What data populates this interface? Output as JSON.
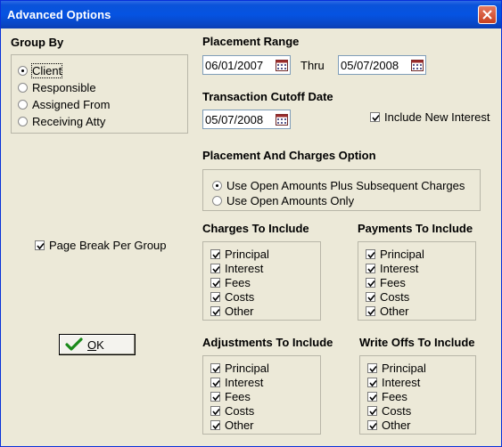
{
  "window": {
    "title": "Advanced Options"
  },
  "group_by": {
    "heading": "Group By",
    "options": [
      {
        "label": "Client",
        "selected": true
      },
      {
        "label": "Responsible",
        "selected": false
      },
      {
        "label": "Assigned From",
        "selected": false
      },
      {
        "label": "Receiving Atty",
        "selected": false
      }
    ]
  },
  "placement_range": {
    "heading": "Placement Range",
    "from": "06/01/2007",
    "thru_label": "Thru",
    "to": "05/07/2008"
  },
  "transaction_cutoff": {
    "heading": "Transaction Cutoff Date",
    "date": "05/07/2008"
  },
  "include_new_interest": {
    "label": "Include New Interest",
    "checked": true
  },
  "placement_charges_option": {
    "heading": "Placement And Charges Option",
    "options": [
      {
        "label": "Use Open Amounts Plus Subsequent Charges",
        "selected": true
      },
      {
        "label": "Use Open Amounts Only",
        "selected": false
      }
    ]
  },
  "page_break": {
    "label": "Page Break Per Group",
    "checked": true
  },
  "charges": {
    "heading": "Charges To Include",
    "items": [
      {
        "label": "Principal",
        "checked": true
      },
      {
        "label": "Interest",
        "checked": true
      },
      {
        "label": "Fees",
        "checked": true
      },
      {
        "label": "Costs",
        "checked": true
      },
      {
        "label": "Other",
        "checked": true
      }
    ]
  },
  "payments": {
    "heading": "Payments To Include",
    "items": [
      {
        "label": "Principal",
        "checked": true
      },
      {
        "label": "Interest",
        "checked": true
      },
      {
        "label": "Fees",
        "checked": true
      },
      {
        "label": "Costs",
        "checked": true
      },
      {
        "label": "Other",
        "checked": true
      }
    ]
  },
  "adjustments": {
    "heading": "Adjustments To Include",
    "items": [
      {
        "label": "Principal",
        "checked": true
      },
      {
        "label": "Interest",
        "checked": true
      },
      {
        "label": "Fees",
        "checked": true
      },
      {
        "label": "Costs",
        "checked": true
      },
      {
        "label": "Other",
        "checked": true
      }
    ]
  },
  "writeoffs": {
    "heading": "Write Offs To Include",
    "items": [
      {
        "label": "Principal",
        "checked": true
      },
      {
        "label": "Interest",
        "checked": true
      },
      {
        "label": "Fees",
        "checked": true
      },
      {
        "label": "Costs",
        "checked": true
      },
      {
        "label": "Other",
        "checked": true
      }
    ]
  },
  "ok_button": {
    "mnemonic": "O",
    "rest": "K",
    "icon": "checkmark-icon"
  }
}
